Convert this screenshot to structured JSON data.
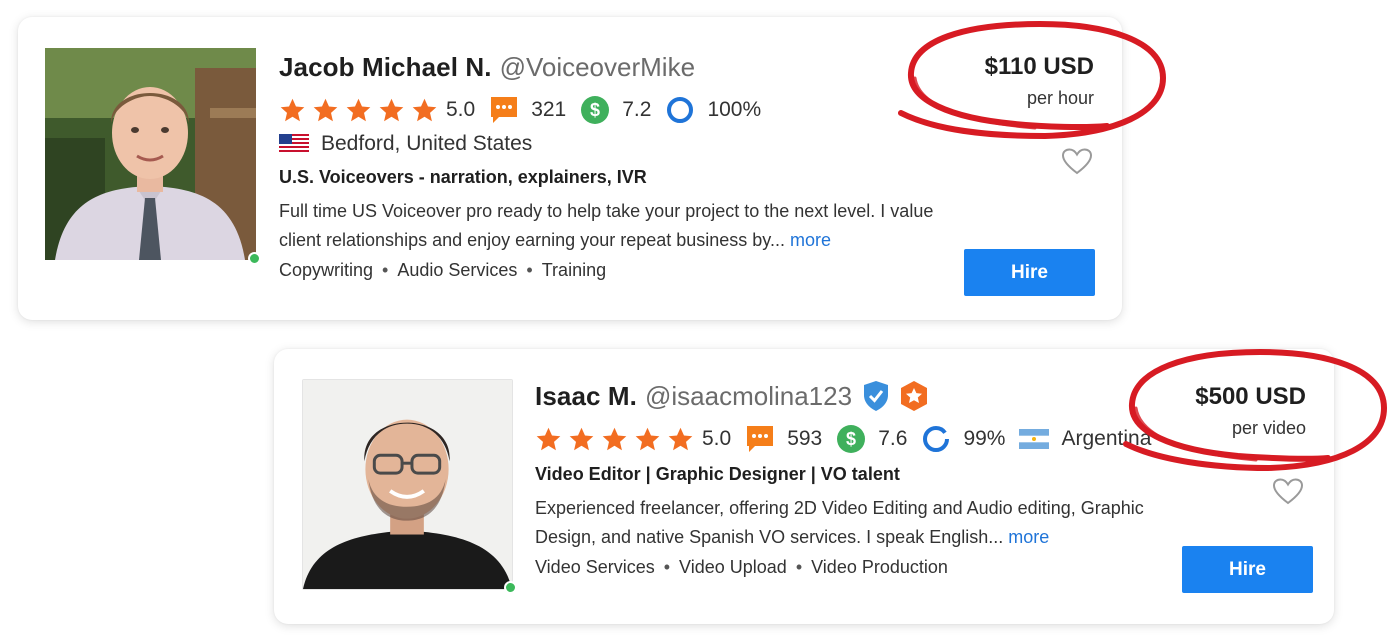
{
  "cards": [
    {
      "name": "Jacob Michael N.",
      "handle": "@VoiceoverMike",
      "rating": "5.0",
      "reviews": "321",
      "earnings_score": "7.2",
      "completion": "100%",
      "location": "Bedford, United States",
      "tagline": "U.S. Voiceovers - narration, explainers, IVR",
      "description": "Full time US Voiceover pro ready to help take your project to the next level. I value client relationships and enjoy earning your repeat business by...",
      "more_label": "more",
      "skills": [
        "Copywriting",
        "Audio Services",
        "Training"
      ],
      "price": "$110 USD",
      "price_unit": "per hour",
      "hire_label": "Hire",
      "flag": "us-flag-icon"
    },
    {
      "name": "Isaac M.",
      "handle": "@isaacmolina123",
      "rating": "5.0",
      "reviews": "593",
      "earnings_score": "7.6",
      "completion": "99%",
      "location": "Argentina",
      "tagline": "Video Editor | Graphic Designer | VO talent",
      "description": "Experienced freelancer, offering 2D Video Editing and Audio editing, Graphic Design, and native Spanish VO services. I speak English...",
      "more_label": "more",
      "skills": [
        "Video Services",
        "Video Upload",
        "Video Production"
      ],
      "price": "$500 USD",
      "price_unit": "per video",
      "hire_label": "Hire",
      "flag": "argentina-flag-icon"
    }
  ],
  "colors": {
    "star": "#f26d21",
    "reviews_icon": "#f57e19",
    "earnings_icon": "#3fb05c",
    "completion_ring": "#1f74d8",
    "hire_button": "#1a82f0",
    "more_link": "#1f74d8",
    "annotation_circle": "#d71b23",
    "verified_badge": "#3a8fdc",
    "preferred_badge": "#f26d21"
  }
}
